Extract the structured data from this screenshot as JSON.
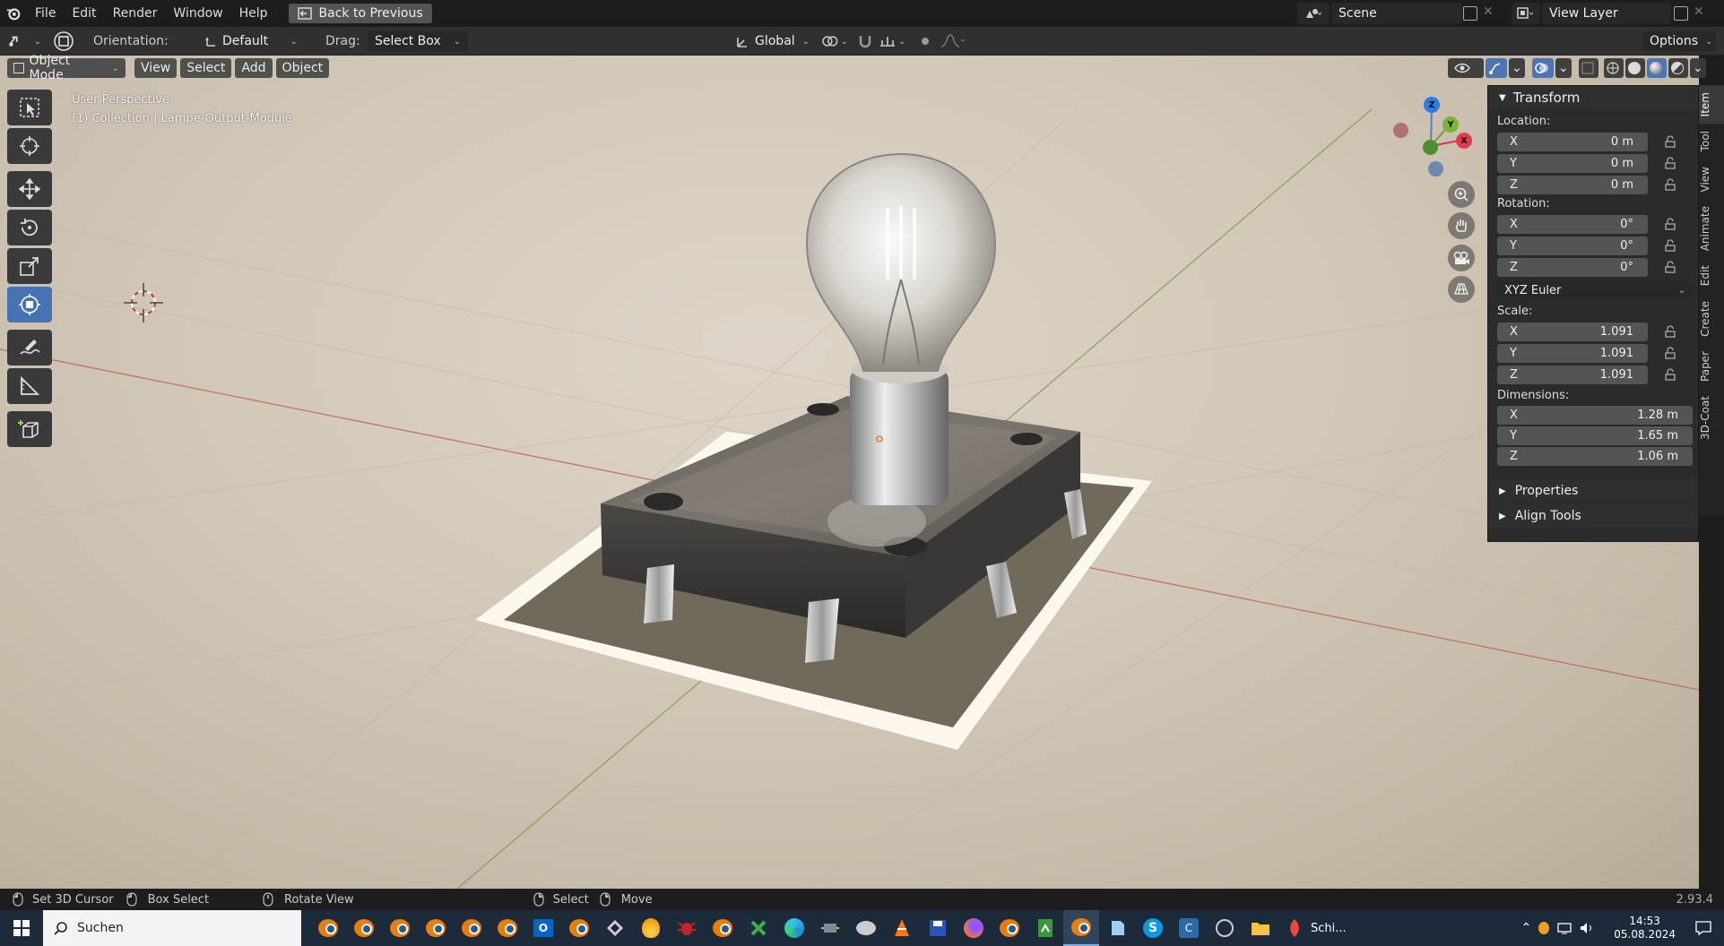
{
  "menu": {
    "file": "File",
    "edit": "Edit",
    "render": "Render",
    "window": "Window",
    "help": "Help",
    "back": "Back to Previous"
  },
  "scene": {
    "scene_name": "Scene",
    "view_layer": "View Layer"
  },
  "header": {
    "orientation_label": "Orientation:",
    "orientation_value": "Default",
    "drag_label": "Drag:",
    "drag_value": "Select Box",
    "transform_space": "Global",
    "options": "Options"
  },
  "viewport_header": {
    "mode": "Object Mode",
    "view": "View",
    "select": "Select",
    "add": "Add",
    "object": "Object"
  },
  "overlay": {
    "perspective": "User Perspective",
    "collection": "(1) Collection | Lampe-Output-Module"
  },
  "gizmo": {
    "x": "X",
    "y": "Y",
    "z": "Z"
  },
  "npanel": {
    "transform": "Transform",
    "location_label": "Location:",
    "location": [
      {
        "axis": "X",
        "value": "0 m"
      },
      {
        "axis": "Y",
        "value": "0 m"
      },
      {
        "axis": "Z",
        "value": "0 m"
      }
    ],
    "rotation_label": "Rotation:",
    "rotation": [
      {
        "axis": "X",
        "value": "0°"
      },
      {
        "axis": "Y",
        "value": "0°"
      },
      {
        "axis": "Z",
        "value": "0°"
      }
    ],
    "rotation_mode": "XYZ Euler",
    "scale_label": "Scale:",
    "scale": [
      {
        "axis": "X",
        "value": "1.091"
      },
      {
        "axis": "Y",
        "value": "1.091"
      },
      {
        "axis": "Z",
        "value": "1.091"
      }
    ],
    "dimensions_label": "Dimensions:",
    "dimensions": [
      {
        "axis": "X",
        "value": "1.28 m"
      },
      {
        "axis": "Y",
        "value": "1.65 m"
      },
      {
        "axis": "Z",
        "value": "1.06 m"
      }
    ],
    "properties": "Properties",
    "align_tools": "Align Tools"
  },
  "tabs": [
    "Item",
    "Tool",
    "View",
    "Animate",
    "Edit",
    "Create",
    "Paper",
    "3D-Coat"
  ],
  "status": {
    "set_cursor": "Set 3D Cursor",
    "box_select": "Box Select",
    "rotate_view": "Rotate View",
    "select": "Select",
    "move": "Move",
    "version": "2.93.4"
  },
  "taskbar": {
    "search": "Suchen",
    "app_label": "Schi...",
    "time": "14:53",
    "date": "05.08.2024"
  }
}
